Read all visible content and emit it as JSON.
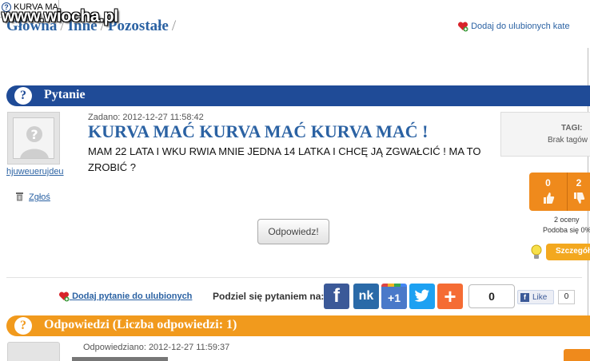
{
  "tab": {
    "title": "KURVA MAĆ"
  },
  "watermark": {
    "text": "www.wiocha.pl"
  },
  "breadcrumb": {
    "items": [
      "Główna",
      "Inne",
      "Pozostałe"
    ],
    "sep": "/"
  },
  "header": {
    "fav_category": "Dodaj do ulubionych kate"
  },
  "question_bar": {
    "title": "Pytanie",
    "icon": "question-icon"
  },
  "question": {
    "author": "hjuweuerujdeu",
    "report": "Zgłoś",
    "asked": "Zadano: 2012-12-27 11:58:42",
    "title": "KURVA MAĆ KURVA MAĆ KURVA MAĆ !",
    "body": "MAM 22 LATA I WKU RWIA MNIE JEDNA 14 LATKA I CHCĘ JĄ ZGWAŁCIĆ ! MA TO ZROBIĆ ?",
    "answer_button": "Odpowiedz!"
  },
  "tags": {
    "label": "TAGI:",
    "value": "Brak tagów"
  },
  "votes": {
    "up": "0",
    "down": "2",
    "ratings": "2 oceny",
    "likes": "Podoba się 0%",
    "details": "Szczegóły"
  },
  "share": {
    "fav_question": "Dodaj pytanie do ulubionych",
    "label": "Podziel się pytaniem na:",
    "facebook": "f",
    "nk": "nk",
    "gplus": "+1",
    "twitter": "t",
    "add": "+",
    "count": "0",
    "fb_like": "Like",
    "like_count": "0"
  },
  "answers_bar": {
    "title": "Odpowiedzi",
    "count": "(Liczba odpowiedzi: 1)"
  },
  "answer": {
    "answered": "Odpowiedziano: 2012-12-27 11:59:37"
  },
  "colors": {
    "blue": "#1f4b97",
    "orange": "#f19a1d",
    "link": "#2b62a3"
  }
}
